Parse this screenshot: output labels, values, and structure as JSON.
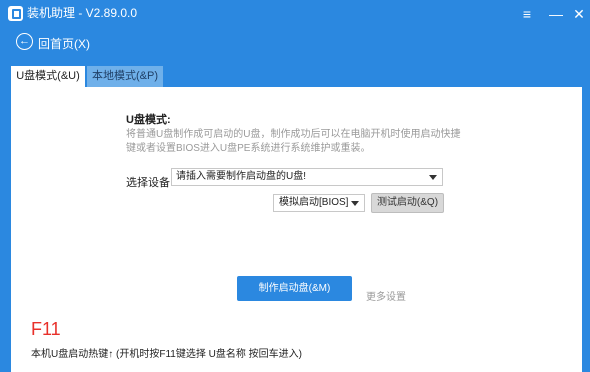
{
  "window": {
    "title": "装机助理 - V2.89.0.0",
    "menu_icon": "menu-icon",
    "minimize_icon": "minimize-icon",
    "close_icon": "close-icon"
  },
  "nav": {
    "back_label": "回首页(X)",
    "back_icon": "back-arrow-icon"
  },
  "tabs": [
    {
      "label": "U盘模式(&U)",
      "active": true
    },
    {
      "label": "本地模式(&P)",
      "active": false
    }
  ],
  "panel": {
    "section_title": "U盘模式:",
    "description": "将普通U盘制作成可启动的U盘，制作成功后可以在电脑开机时使用启动快捷键或者设置BIOS进入U盘PE系统进行系统维护或重装。",
    "device_label": "选择设备:",
    "device_value": "请插入需要制作启动盘的U盘!",
    "boot_mode_value": "模拟启动[BIOS]",
    "test_button": "测试启动(&Q)",
    "make_button": "制作启动盘(&M)",
    "more_settings": "更多设置"
  },
  "hotkey": {
    "key": "F11",
    "description": "本机U盘启动热键↑ (开机时按F11键选择 U盘名称 按回车进入)"
  },
  "colors": {
    "accent": "#2b88e0",
    "hotkey": "#e8302a",
    "inactive_tab": "#6fb0ea"
  }
}
